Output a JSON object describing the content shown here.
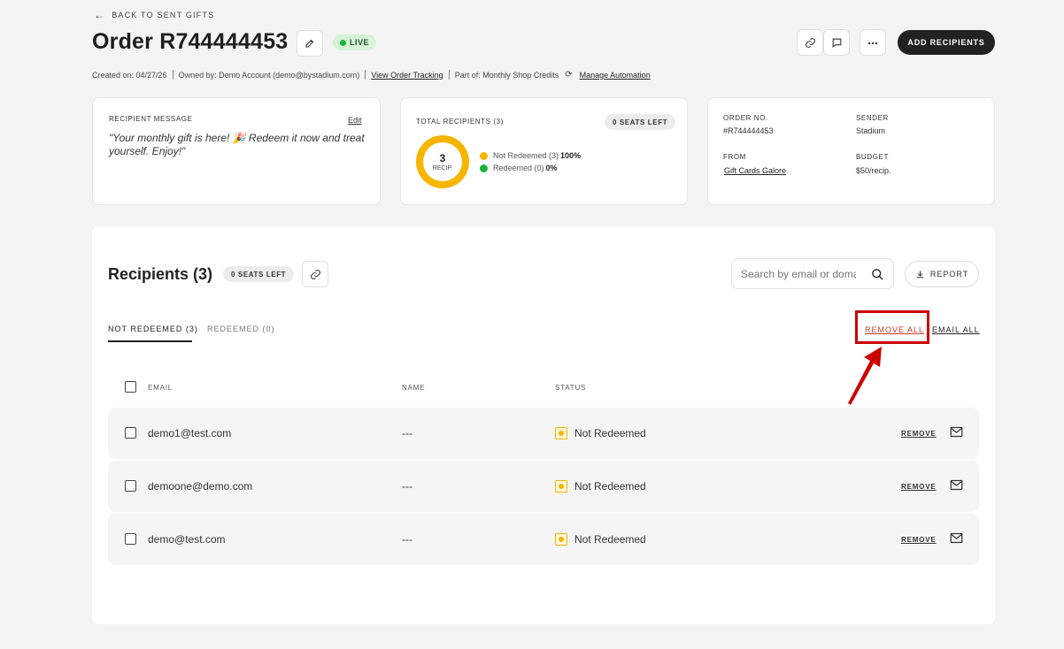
{
  "header": {
    "back_label": "BACK TO SENT GIFTS",
    "title": "Order R744444453",
    "status_badge": "LIVE",
    "add_recipients_label": "ADD RECIPIENTS"
  },
  "meta": {
    "created": "Created on: 04/27/26",
    "owned_by": "Owned by: Demo Account (demo@bystadium.com)",
    "tracking_link": "View Order Tracking",
    "part_of": "Part of: Monthly Shop Credits",
    "automation_link": "Manage Automation"
  },
  "message_card": {
    "label": "RECIPIENT MESSAGE",
    "edit_label": "Edit",
    "message": "\"Your monthly gift is here! 🎉 Redeem it now and treat yourself. Enjoy!\""
  },
  "totals_card": {
    "label": "TOTAL RECIPIENTS (3)",
    "seats_badge": "0 SEATS LEFT",
    "donut_count": "3",
    "donut_unit": "RECIP.",
    "legend": [
      {
        "label": "Not Redeemed (3)",
        "percent": "100%",
        "color": "#f7b500"
      },
      {
        "label": "Redeemed (0)",
        "percent": "0%",
        "color": "#19b23a"
      }
    ],
    "not_redeemed_fraction": 1.0
  },
  "order_card": {
    "order_no_label": "ORDER NO.",
    "order_no_value": "#R744444453",
    "sender_label": "SENDER",
    "sender_value": "Stadium",
    "from_label": "FROM",
    "from_value": "Gift Cards Galore",
    "budget_label": "BUDGET",
    "budget_value": "$50/recip."
  },
  "recipients": {
    "title": "Recipients (3)",
    "seats_badge": "0 SEATS LEFT",
    "search_placeholder": "Search by email or domain",
    "report_label": "REPORT",
    "tabs": [
      {
        "label": "NOT REDEEMED (3)",
        "active": true
      },
      {
        "label": "REDEEMED (0)",
        "active": false
      }
    ],
    "remove_all_label": "REMOVE ALL",
    "email_all_label": "EMAIL ALL",
    "columns": {
      "email": "EMAIL",
      "name": "NAME",
      "status": "STATUS"
    },
    "rows": [
      {
        "email": "demo1@test.com",
        "name": "---",
        "status": "Not Redeemed",
        "remove_label": "REMOVE"
      },
      {
        "email": "demoone@demo.com",
        "name": "---",
        "status": "Not Redeemed",
        "remove_label": "REMOVE"
      },
      {
        "email": "demo@test.com",
        "name": "---",
        "status": "Not Redeemed",
        "remove_label": "REMOVE"
      }
    ]
  },
  "colors": {
    "accent_dark": "#222222",
    "live_green": "#19b23a",
    "pending_yellow": "#f7b500",
    "highlight_red": "#cc0000"
  }
}
